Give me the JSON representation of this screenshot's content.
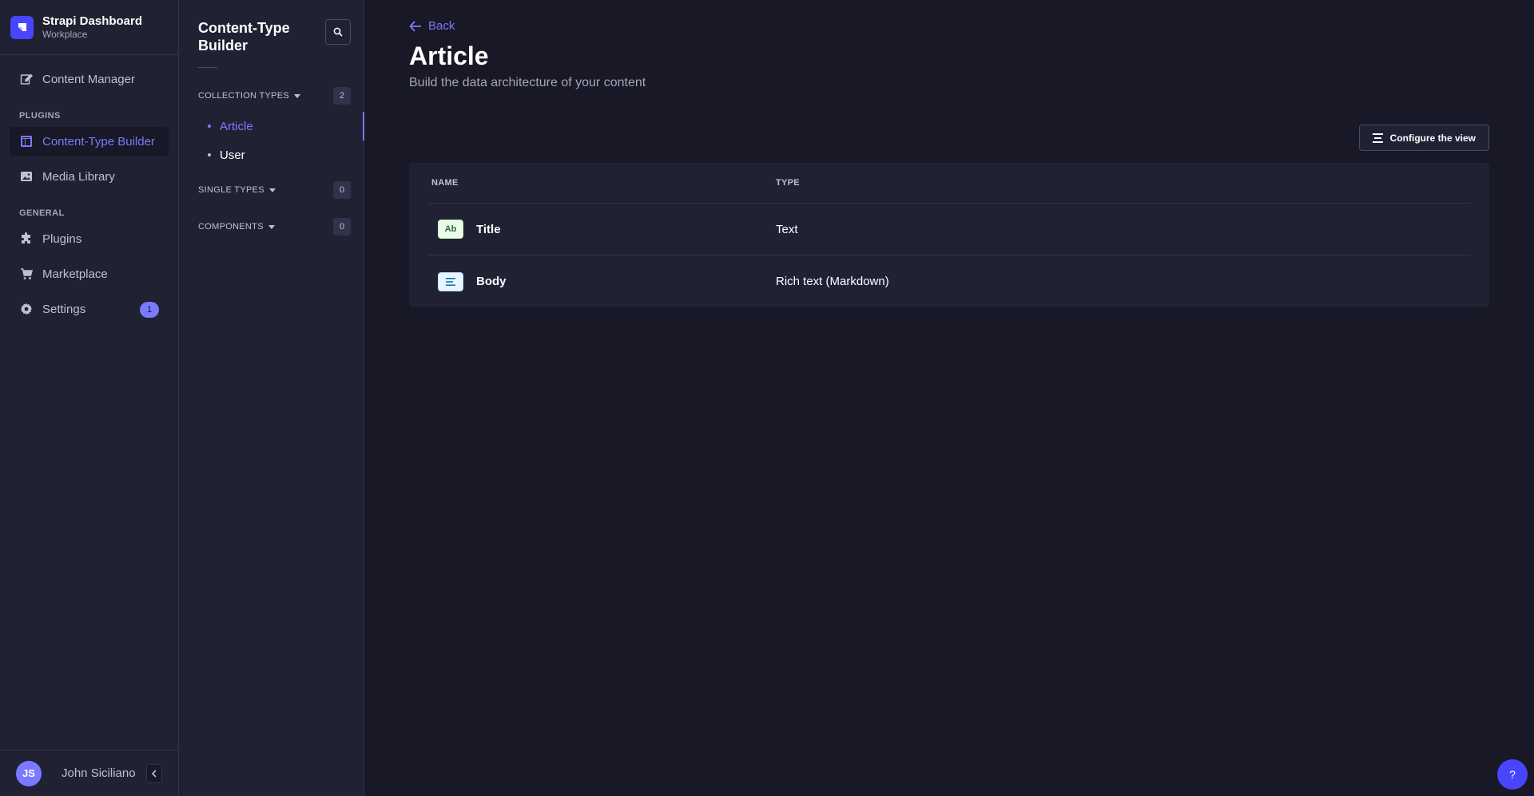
{
  "brand": {
    "title": "Strapi Dashboard",
    "subtitle": "Workplace"
  },
  "mainnav": {
    "content_manager": "Content Manager",
    "plugins_section": "PLUGINS",
    "content_type_builder": "Content-Type Builder",
    "media_library": "Media Library",
    "general_section": "GENERAL",
    "plugins": "Plugins",
    "marketplace": "Marketplace",
    "settings": "Settings",
    "settings_badge": "1"
  },
  "user": {
    "initials": "JS",
    "name": "John Siciliano"
  },
  "subnav": {
    "title": "Content-Type Builder",
    "collection_types": {
      "label": "COLLECTION TYPES",
      "count": "2",
      "items": [
        "Article",
        "User"
      ]
    },
    "single_types": {
      "label": "SINGLE TYPES",
      "count": "0"
    },
    "components": {
      "label": "COMPONENTS",
      "count": "0"
    }
  },
  "main": {
    "back_label": "Back",
    "title": "Article",
    "subtitle": "Build the data architecture of your content",
    "configure_label": "Configure the view",
    "table": {
      "headers": {
        "name": "NAME",
        "type": "TYPE"
      },
      "rows": [
        {
          "icon_label": "Ab",
          "name": "Title",
          "type": "Text"
        },
        {
          "icon_label": "",
          "name": "Body",
          "type": "Rich text (Markdown)"
        }
      ]
    },
    "help_label": "?"
  },
  "colors": {
    "background": "#181826",
    "panel": "#212134",
    "accent": "#7b79ff",
    "primary": "#4945ff"
  },
  "icons": {
    "brand": "strapi-logo-icon",
    "content_manager": "pencil-icon",
    "content_type_builder": "layout-icon",
    "media_library": "picture-icon",
    "plugins": "puzzle-icon",
    "marketplace": "cart-icon",
    "settings": "gear-icon",
    "search": "search-icon",
    "back": "arrow-left-icon",
    "configure": "list-icon",
    "collapse": "chevron-left-icon"
  }
}
